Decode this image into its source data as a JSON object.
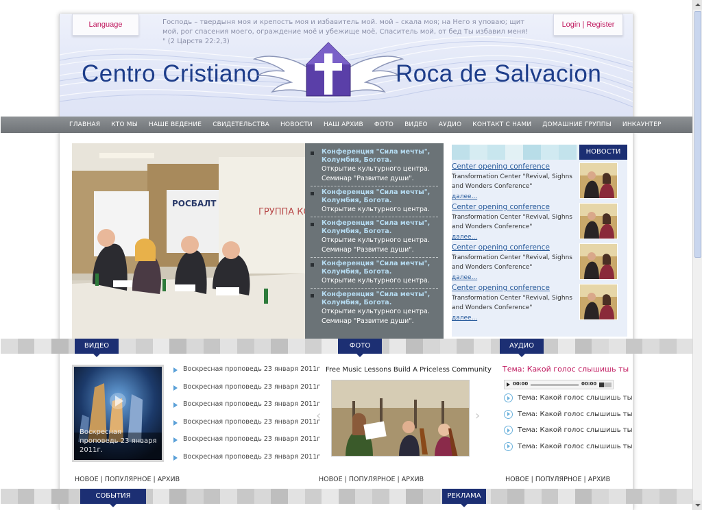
{
  "header": {
    "language_label": "Language",
    "login_label": "Login",
    "auth_separator": "|",
    "register_label": "Register",
    "verse": "Господь – твердыня моя и крепость моя и избавитель мой. мой – скала моя; на Него я уповаю; щит мой, рог спасения моего, ограждение моё и убежище моё, Спаситель мой, от бед Ты избавил меня! \" (2 Царств 22:2,3)",
    "logo_left": "Centro Cristiano",
    "logo_right": "Roca de Salvacion"
  },
  "nav": {
    "items": [
      "ГЛАВНАЯ",
      "КТО МЫ",
      "НАШЕ ВЕДЕНИЕ",
      "СВИДЕТЕЛЬСТВА",
      "НОВОСТИ",
      "НАШ АРХИВ",
      "ФОТО",
      "ВИДЕО",
      "АУДИО",
      "КОНТАКТ С НАМИ",
      "ДОМАШНИЕ ГРУППЫ",
      "ИНКАУНТЕР"
    ]
  },
  "hero": {
    "image_sign_left": "РОСБАЛТ",
    "image_sign_right": "ГРУППА КОМ",
    "news": [
      {
        "title": "Конференция \"Сила мечты\", Колумбия, Богота.",
        "lines": [
          "Открытие культурного центра.",
          "Семинар \"Развитие души\"."
        ]
      },
      {
        "title": "Конференция \"Сила мечты\", Колумбия, Богота.",
        "lines": [
          "Открытие культурного центра."
        ]
      },
      {
        "title": "Конференция \"Сила мечты\", Колумбия, Богота.",
        "lines": [
          "Открытие культурного центра.",
          "Семинар \"Развитие души\"."
        ]
      },
      {
        "title": "Конференция \"Сила мечты\", Колумбия, Богота.",
        "lines": [
          "Открытие культурного центра."
        ]
      },
      {
        "title": "Конференция \"Сила мечты\", Колумбия, Богота.",
        "lines": [
          "Открытие культурного центра.",
          "Семинар \"Развитие души\"."
        ]
      }
    ]
  },
  "news_sidebar": {
    "tab_label": "НОВОСТИ",
    "items": [
      {
        "link": "Center opening conference",
        "desc": "Transformation Center \"Revival, Sighns and Wonders Conference\"",
        "more": "далее..."
      },
      {
        "link": "Center opening conference",
        "desc": "Transformation Center \"Revival, Sighns and Wonders Conference\"",
        "more": "далее..."
      },
      {
        "link": "Center opening conference",
        "desc": "Transformation Center \"Revival, Sighns and Wonders Conference\"",
        "more": "далее..."
      },
      {
        "link": "Center opening conference",
        "desc": "Transformation Center \"Revival, Sighns and Wonders Conference\"",
        "more": "далее..."
      }
    ]
  },
  "sections": {
    "video_tab": "ВИДЕО",
    "photo_tab": "ФОТО",
    "audio_tab": "АУДИО",
    "events_tab": "СОБЫТИЯ",
    "ads_tab": "РЕКЛАМА"
  },
  "video": {
    "caption": "Воскресная проповедь 23 января 2011г.",
    "list": [
      "Воскресная проповедь 23 января 2011г",
      "Воскресная проповедь 23 января 2011г",
      "Воскресная проповедь 23 января 2011г",
      "Воскресная проповедь 23 января 2011г",
      "Воскресная проповедь 23 января 2011г",
      "Воскресная проповедь 23 января 2011г"
    ],
    "links": "НОВОЕ | ПОПУЛЯРНОЕ | АРХИВ"
  },
  "photo": {
    "title": "Free Music Lessons Build A Priceless Community",
    "prev_arrow": "‹",
    "next_arrow": "›",
    "links": "НОВОЕ | ПОПУЛЯРНОЕ | АРХИВ"
  },
  "audio": {
    "title": "Тема: Какой голос слышишь ты",
    "time_current": "00:00",
    "time_total": "00:00",
    "list": [
      "Тема: Какой голос слышишь ты",
      "Тема: Какой голос слышишь ты",
      "Тема: Какой голос слышишь ты",
      "Тема: Какой голос слышишь ты"
    ],
    "links": "НОВОЕ | ПОПУЛЯРНОЕ | АРХИВ"
  },
  "colors": {
    "accent_pink": "#c0185e",
    "tab_navy": "#1c2f73",
    "logo_blue": "#1d3d8a",
    "nav_gray": "#7a7e82",
    "panel_gray": "#6b7377"
  }
}
